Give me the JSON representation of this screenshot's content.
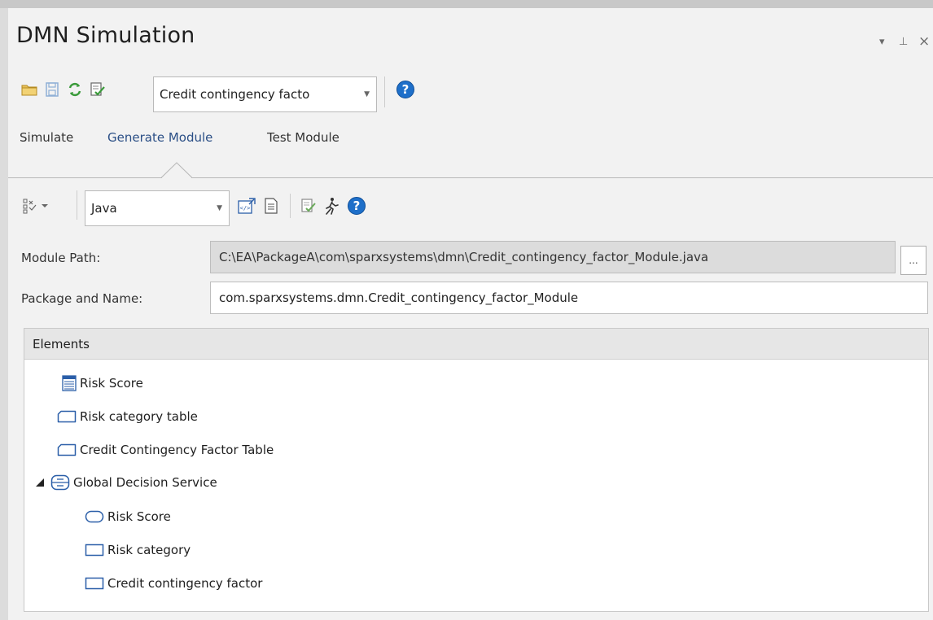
{
  "window": {
    "title": "DMN Simulation",
    "controls": {
      "dropdown": "▾",
      "pin": "⊥",
      "close": "×"
    }
  },
  "toolbar1": {
    "simulation_select": "Credit contingency facto",
    "icons": [
      "open-folder-icon",
      "save-icon",
      "refresh-icon",
      "validate-icon",
      "help-icon"
    ]
  },
  "tabs": [
    {
      "label": "Simulate",
      "active": false
    },
    {
      "label": "Generate Module",
      "active": true
    },
    {
      "label": "Test Module",
      "active": false
    }
  ],
  "toolbar2": {
    "language_select": "Java",
    "icons": [
      "options-icon",
      "generate-code-icon",
      "document-icon",
      "compile-icon",
      "run-icon",
      "help-icon"
    ]
  },
  "form": {
    "module_path_label": "Module Path:",
    "module_path_value": "C:\\EA\\PackageA\\com\\sparxsystems\\dmn\\Credit_contingency_factor_Module.java",
    "browse_label": "...",
    "package_name_label": "Package and Name:",
    "package_name_value": "com.sparxsystems.dmn.Credit_contingency_factor_Module"
  },
  "elements": {
    "header": "Elements",
    "items": [
      {
        "label": "Risk Score",
        "icon": "business-knowledge-icon",
        "level": 0
      },
      {
        "label": "Risk category table",
        "icon": "decision-table-icon",
        "level": 0
      },
      {
        "label": "Credit Contingency Factor Table",
        "icon": "decision-table-icon",
        "level": 0
      },
      {
        "label": "Global Decision Service",
        "icon": "decision-service-icon",
        "level": 0,
        "expanded": true
      },
      {
        "label": "Risk Score",
        "icon": "input-data-icon",
        "level": 1
      },
      {
        "label": "Risk category",
        "icon": "decision-icon",
        "level": 1
      },
      {
        "label": "Credit contingency factor",
        "icon": "decision-icon",
        "level": 1
      }
    ]
  },
  "colors": {
    "accent_blue": "#2a5ea8",
    "help_blue": "#1e6fc9",
    "tab_active": "#2b4f86",
    "tree_bg": "#ffffff",
    "panel_bg": "#f2f2f2"
  }
}
